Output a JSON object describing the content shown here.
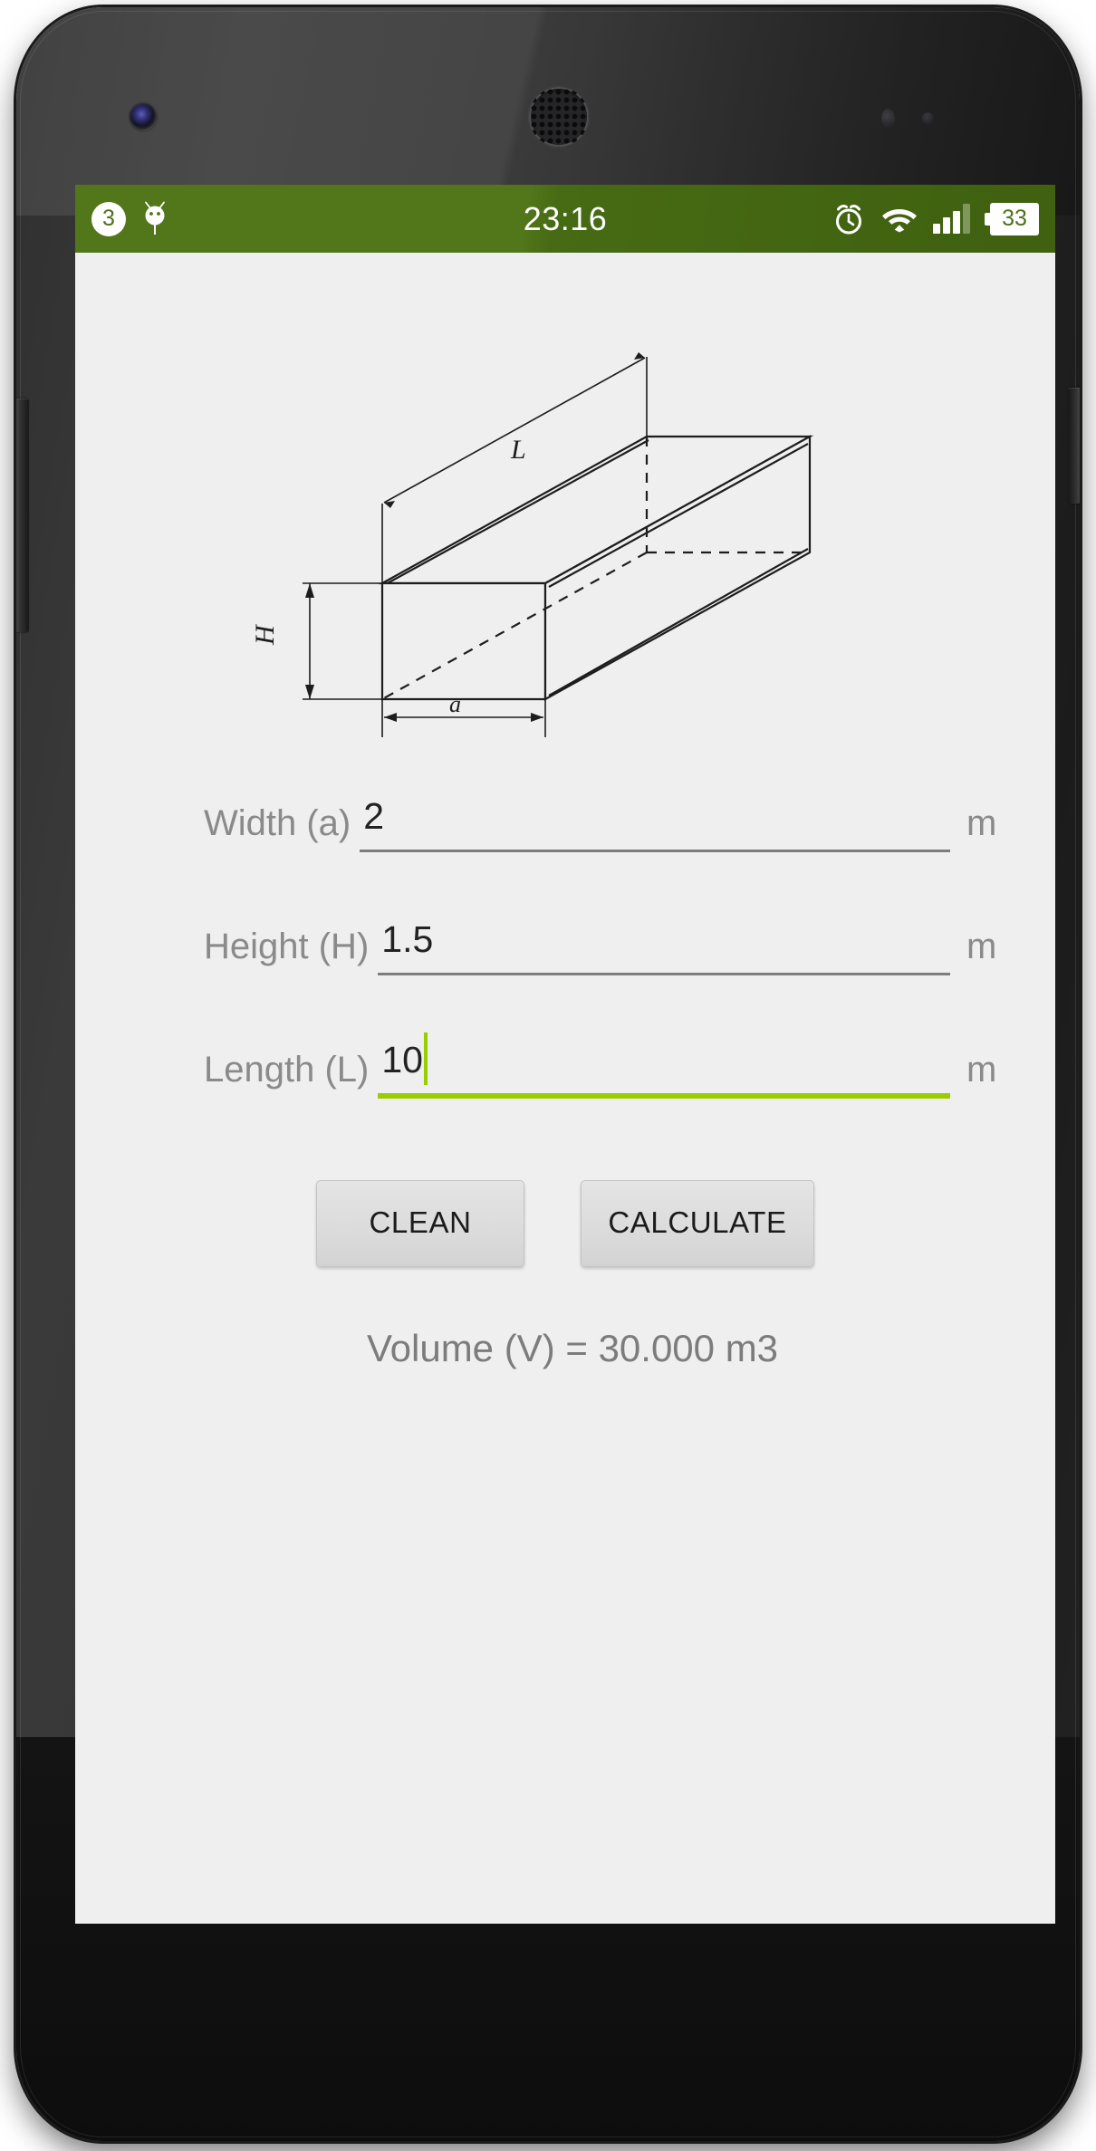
{
  "device": {
    "type": "android-smartphone",
    "hardware": {
      "front_camera": "front-camera",
      "earpiece": "earpiece-speaker",
      "proximity_sensor": "proximity-sensor",
      "light_sensor": "light-sensor",
      "volume_button": "volume-rocker",
      "power_button": "power-button"
    }
  },
  "status_bar": {
    "background_color": "#4d7119",
    "notification_count": "3",
    "notification_icons": [
      "notification-count-badge",
      "android-debug-icon"
    ],
    "clock": "23:16",
    "alarm_icon": "alarm-clock-icon",
    "wifi_icon": "wifi-icon",
    "signal": {
      "icon": "cellular-signal-icon",
      "bars_filled": 3,
      "bars_total": 4
    },
    "battery": {
      "icon": "battery-icon",
      "level": "33"
    }
  },
  "app": {
    "background_color": "#efefef",
    "figure": {
      "name": "rectangular-parallelepiped-diagram",
      "shape": "cuboid",
      "labels": {
        "length": "L",
        "height": "H",
        "width": "a"
      }
    },
    "fields": [
      {
        "id": "width",
        "label": "Width (a)",
        "value": "2",
        "unit": "m",
        "focused": false
      },
      {
        "id": "height",
        "label": "Height (H)",
        "value": "1.5",
        "unit": "m",
        "focused": false
      },
      {
        "id": "length",
        "label": "Length (L)",
        "value": "10",
        "unit": "m",
        "focused": true
      }
    ],
    "buttons": {
      "clean": "CLEAN",
      "calculate": "CALCULATE"
    },
    "result": "Volume (V) = 30.000 m3",
    "accent_color": "#9acd00",
    "label_color": "#8a8a8a",
    "value_color": "#222222"
  }
}
